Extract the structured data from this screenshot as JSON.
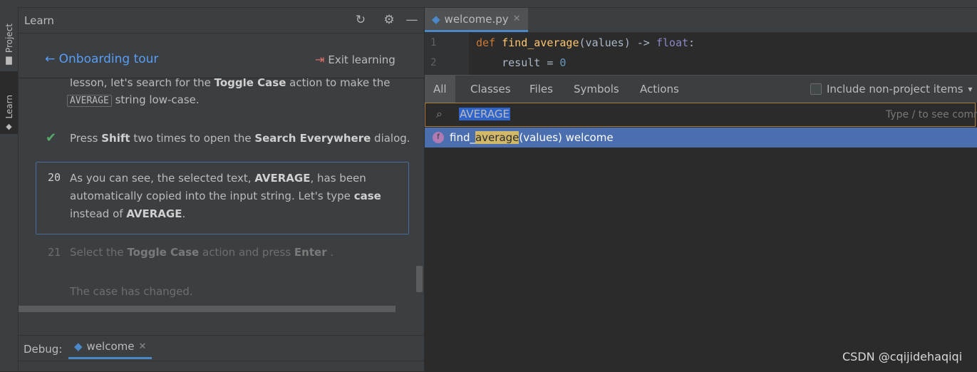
{
  "learn_panel": {
    "title": "Learn",
    "back_link": "Onboarding tour",
    "exit_link": "Exit learning",
    "stripe_project": "Project",
    "stripe_learn": "Learn",
    "step_prev": {
      "line1_a": "lesson, let's search for the ",
      "line1_b": "Toggle Case",
      "line1_c": " action to make the",
      "kbd": "AVERAGE",
      "line2_c": " string low-case."
    },
    "step_done": {
      "a": "Press ",
      "b": "Shift",
      "c": " two times to open the ",
      "d": "Search Everywhere",
      "e": " dialog."
    },
    "step_current": {
      "num": "20",
      "l1a": "As you can see, the selected text, ",
      "l1b": "AVERAGE",
      "l1c": ", has been",
      "l2a": "automatically copied into the input string. Let's type ",
      "l2b": "case",
      "l3a": "instead of ",
      "l3b": "AVERAGE",
      "l3c": "."
    },
    "step_next": {
      "num": "21",
      "a": "Select the ",
      "b": "Toggle Case",
      "c": " action and press ",
      "d": "Enter",
      "e": " ."
    },
    "step_note": "The case has changed.",
    "debug_label": "Debug:",
    "debug_tab": "welcome"
  },
  "editor": {
    "file_tab": "welcome.py",
    "line_numbers": [
      "1",
      "2"
    ],
    "code_line1": {
      "kw": "def",
      "fn": "find_average",
      "rest": "(values) -> ",
      "type": "float",
      "end": ":"
    },
    "code_line2": {
      "text": "    result = ",
      "num": "0"
    }
  },
  "search_everywhere": {
    "tabs": [
      "All",
      "Classes",
      "Files",
      "Symbols",
      "Actions"
    ],
    "non_project": "Include non-project items",
    "query": "AVERAGE",
    "hint": "Type / to see commands",
    "result": {
      "icon": "f",
      "prefix": "find_",
      "match": "average",
      "suffix": "(values) welcome"
    }
  },
  "watermark": "CSDN @cqijidehaqiqi"
}
